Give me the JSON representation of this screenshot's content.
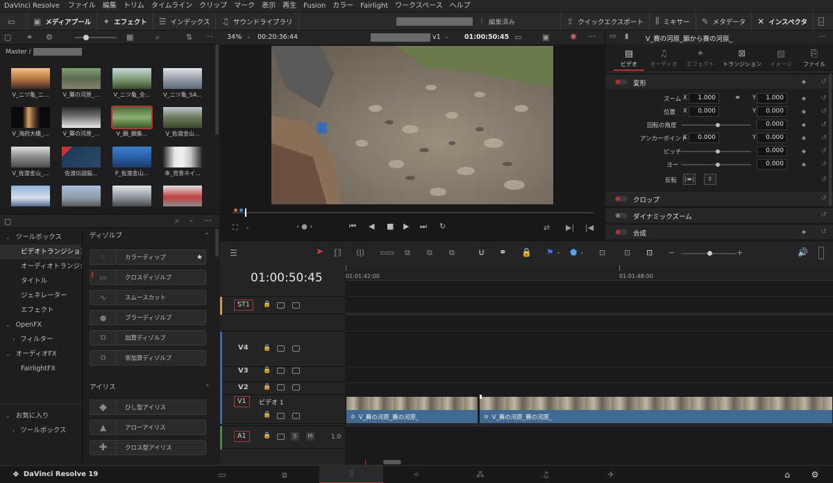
{
  "menubar": {
    "app": "DaVinci Resolve",
    "items": [
      "ファイル",
      "編集",
      "トリム",
      "タイムライン",
      "クリップ",
      "マーク",
      "表示",
      "再生",
      "Fusion",
      "カラー",
      "Fairlight",
      "ワークスペース",
      "ヘルプ"
    ]
  },
  "toolbar": {
    "media_pool": "メディアプール",
    "effects": "エフェクト",
    "index": "インデックス",
    "sound_library": "サウンドライブラリ",
    "edited_status": "編集済み",
    "quick_export": "クイックエクスポート",
    "mixer": "ミキサー",
    "metadata": "メタデータ",
    "inspector": "インスペクタ"
  },
  "mediapool": {
    "bin": "Master /",
    "clips": [
      "V_ニツ亀_ニ...",
      "V_賽の河原_...",
      "V_ニツ亀_全...",
      "V_ニツ亀_SA...",
      "V_海府大橋_...",
      "V_賽の河原_...",
      "V_願_願集...",
      "V_佐渡金山...",
      "V_佐渡金山_...",
      "佐渡伝説殺...",
      "P_佐渡金山...",
      "本_背景ネイ..."
    ]
  },
  "viewer": {
    "zoom": "34%",
    "duration": "00:20:36:44",
    "track": "v1",
    "timecode": "01:00:50:45"
  },
  "inspector": {
    "clip_title": "V_賽の河原_願から賽の河原_",
    "tabs": [
      "ビデオ",
      "オーディオ",
      "エフェクト",
      "トランジション",
      "イメージ",
      "ファイル"
    ],
    "transform": "変形",
    "zoom_label": "ズーム",
    "zoom_x": "1.000",
    "zoom_y": "1.000",
    "position_label": "位置",
    "pos_x": "0.000",
    "pos_y": "0.000",
    "rotation_label": "回転の角度",
    "rotation": "0.000",
    "anchor_label": "アンカーポイント",
    "anchor_x": "0.000",
    "anchor_y": "0.000",
    "pitch_label": "ピッチ",
    "pitch": "0.000",
    "yaw_label": "ヨー",
    "yaw": "0.000",
    "flip_label": "反転",
    "x": "X",
    "y": "Y",
    "crop": "クロップ",
    "dynamic_zoom": "ダイナミックズーム",
    "composite": "合成"
  },
  "effects": {
    "tree": [
      "ツールボックス",
      "ビデオトランジション",
      "オーディオトランジシ...",
      "タイトル",
      "ジェネレーター",
      "エフェクト",
      "OpenFX",
      "フィルター",
      "オーディオFX",
      "FairlightFX",
      "お気に入り",
      "ツールボックス"
    ],
    "dissolve_header": "ディゾルブ",
    "dissolves": [
      "カラーディップ",
      "クロスディゾルブ",
      "スムースカット",
      "ブラーディゾルブ",
      "加算ディゾルブ",
      "非加算ディゾルブ"
    ],
    "iris_header": "アイリス",
    "iris": [
      "ひし型アイリス",
      "アローアイリス",
      "クロス型アイリス"
    ]
  },
  "timeline": {
    "timecode": "01:00:50:45",
    "ruler": [
      "01:01:42:00",
      "01:01:48:00"
    ],
    "tracks": {
      "st": "ST1",
      "v4": "V4",
      "v3": "V3",
      "v2": "V2",
      "v1": "V1",
      "v1_name": "ビデオ 1",
      "a1": "A1",
      "a1_level": "1.0"
    },
    "clips": [
      "V_賽の河原_賽の河原_",
      "V_賽の河原_賽の河原_"
    ]
  },
  "footer": {
    "app_version": "DaVinci Resolve 19"
  }
}
